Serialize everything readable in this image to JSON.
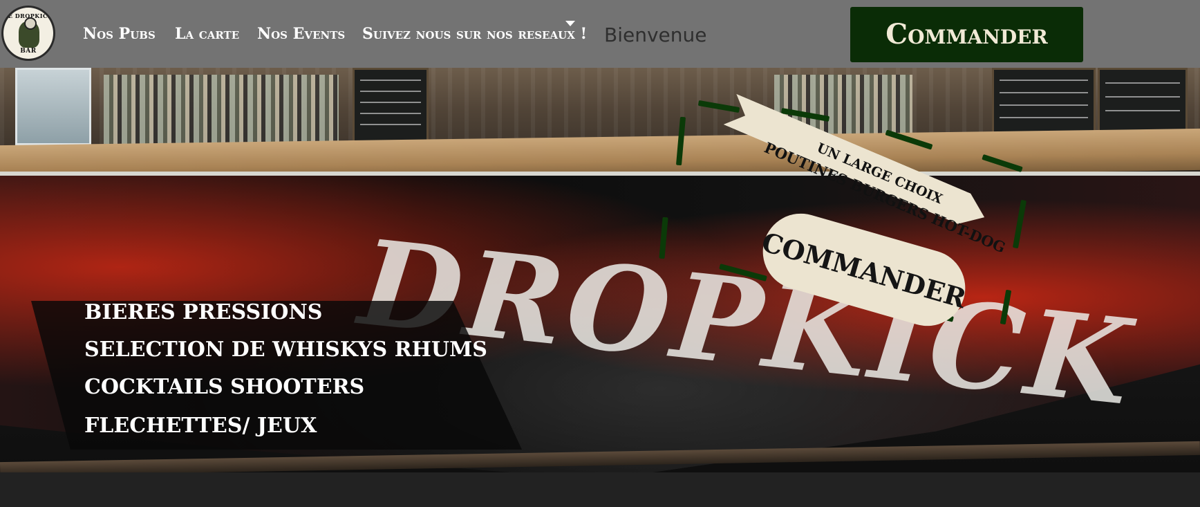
{
  "header": {
    "logo_text_top": "LE DROPKICK",
    "logo_text_bottom": "BAR",
    "nav": [
      {
        "label": "Nos Pubs"
      },
      {
        "label": "La carte"
      },
      {
        "label": "Nos Events"
      },
      {
        "label": "Suivez nous sur nos reseaux !"
      }
    ],
    "welcome_text": "Bienvenue",
    "cta_label": "Commander"
  },
  "hero": {
    "mural_text": "DROPKICK",
    "menu_items": [
      "BIERES PRESSIONS",
      "SELECTION DE WHISKYS RHUMS",
      "COCKTAILS SHOOTERS",
      "FLECHETTES/ JEUX"
    ],
    "promo": {
      "line1": "UN LARGE CHOIX",
      "line2": "POUTINES BURGERS HOT-DOG",
      "button_label": "COMMANDER"
    }
  },
  "colors": {
    "header_bg": "#737373",
    "cta_bg": "#0a2c06",
    "cta_text": "#f1ead6",
    "promo_dash": "#0b3a08"
  }
}
